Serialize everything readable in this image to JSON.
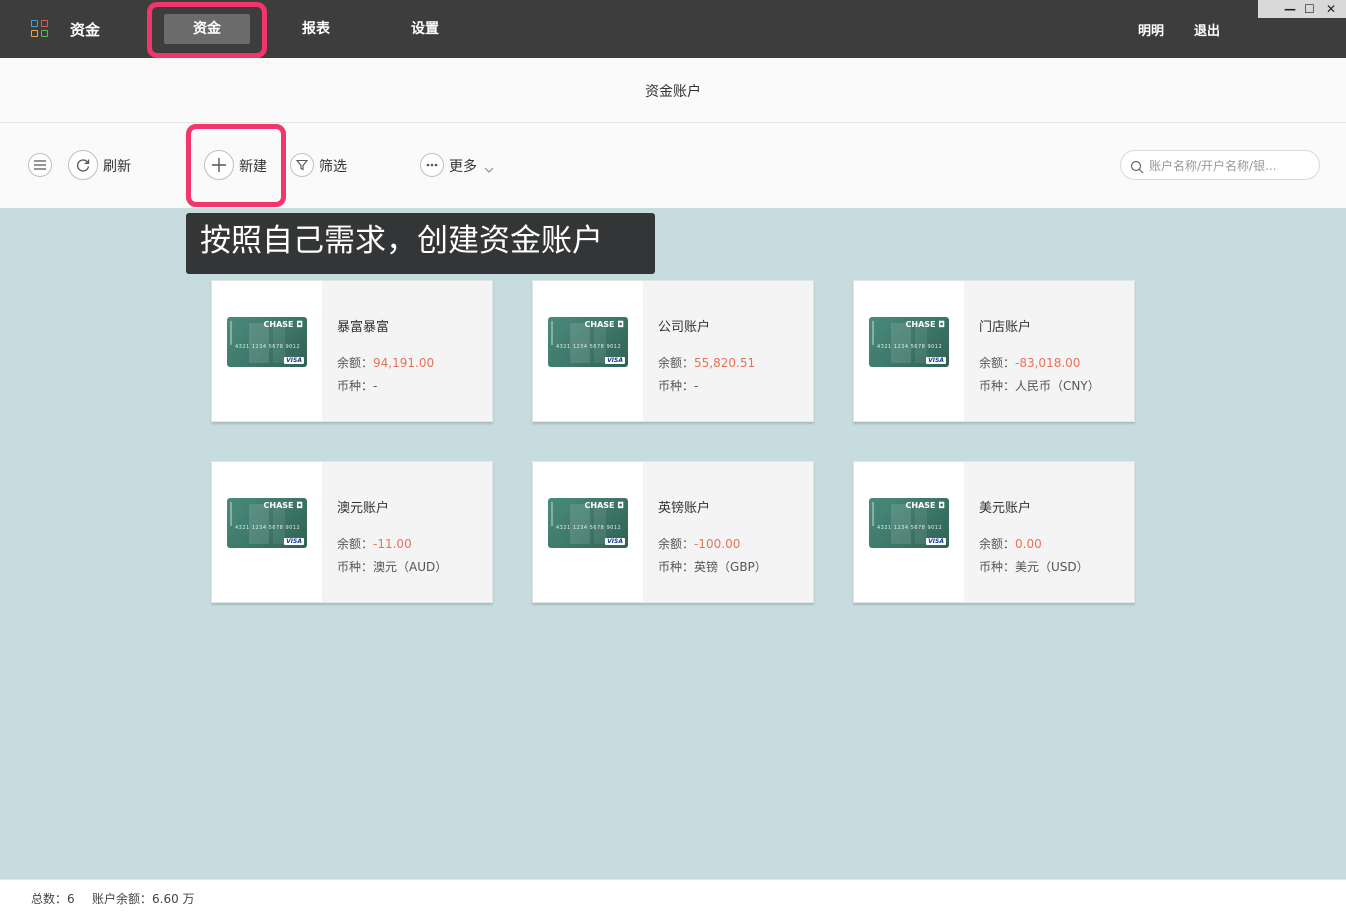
{
  "app": {
    "title": "资金"
  },
  "nav": {
    "tabs": [
      {
        "label": "资金"
      },
      {
        "label": "报表"
      },
      {
        "label": "设置"
      }
    ]
  },
  "user": {
    "name": "明明",
    "logout": "退出"
  },
  "window": {
    "minimize": "—",
    "maximize": "☐",
    "close": "✕"
  },
  "page": {
    "title": "资金账户"
  },
  "toolbar": {
    "refresh": "刷新",
    "new": "新建",
    "filter": "筛选",
    "more": "更多"
  },
  "search": {
    "placeholder": "账户名称/开户名称/银..."
  },
  "tooltip": {
    "text": "按照自己需求，创建资金账户"
  },
  "card_art": {
    "brand": "CHASE ◘",
    "number": "4321 1234 5678 9012",
    "network": "VISA"
  },
  "labels": {
    "balance": "余额：",
    "currency": "币种："
  },
  "accounts": [
    {
      "name": "暴富暴富",
      "balance": "94,191.00",
      "currency": "-"
    },
    {
      "name": "公司账户",
      "balance": "55,820.51",
      "currency": "-"
    },
    {
      "name": "门店账户",
      "balance": "-83,018.00",
      "currency": "人民币（CNY）"
    },
    {
      "name": "澳元账户",
      "balance": "-11.00",
      "currency": "澳元（AUD）"
    },
    {
      "name": "英镑账户",
      "balance": "-100.00",
      "currency": "英镑（GBP）"
    },
    {
      "name": "美元账户",
      "balance": "0.00",
      "currency": "美元（USD）"
    }
  ],
  "footer": {
    "total": "总数：6",
    "balance": "账户余额：6.60 万"
  },
  "colors": {
    "topbar": "#3d3d3d",
    "content_bg": "#c7dcde",
    "highlight": "#f2356b",
    "balance_red": "#e8735a"
  }
}
